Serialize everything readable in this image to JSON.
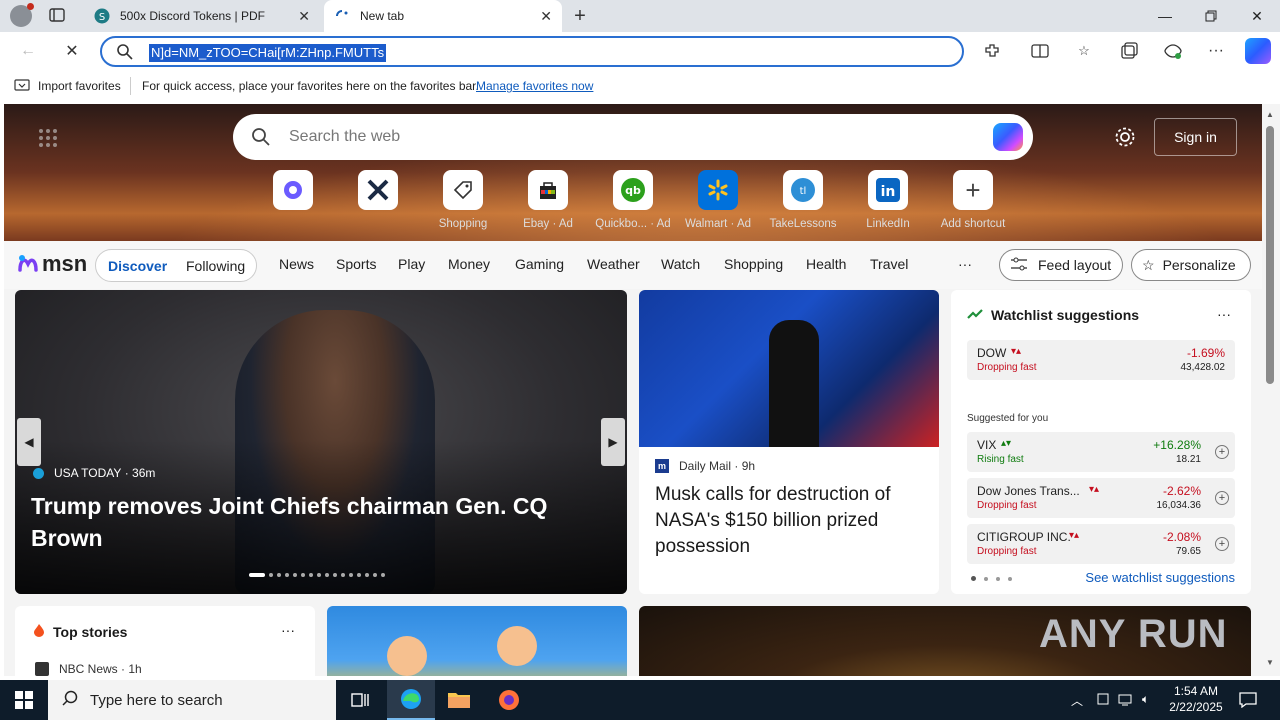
{
  "tabs": [
    {
      "title": "500x Discord Tokens | PDF"
    },
    {
      "title": "New tab"
    }
  ],
  "address": {
    "selected_text": "N]d=NM_zTOO=CHai[rM:ZHnp.FMUTTs"
  },
  "favorites": {
    "import_label": "Import favorites",
    "message": "For quick access, place your favorites here on the favorites bar.",
    "manage_link": "Manage favorites now"
  },
  "newtab": {
    "search_placeholder": "Search the web",
    "signin": "Sign in",
    "quicklinks": [
      {
        "label": ""
      },
      {
        "label": ""
      },
      {
        "label": "Shopping"
      },
      {
        "label": "Ebay · Ad"
      },
      {
        "label": "Quickbo... · Ad"
      },
      {
        "label": "Walmart · Ad"
      },
      {
        "label": "TakeLessons"
      },
      {
        "label": "LinkedIn"
      },
      {
        "label": "Add shortcut"
      }
    ]
  },
  "msn": {
    "logo": "msn",
    "tabs": [
      "Discover",
      "Following"
    ],
    "nav": [
      "News",
      "Sports",
      "Play",
      "Money",
      "Gaming",
      "Weather",
      "Watch",
      "Shopping",
      "Health",
      "Travel"
    ],
    "more": "···",
    "feed_layout": "Feed layout",
    "personalize": "Personalize"
  },
  "lead": {
    "source": "USA TODAY",
    "time": "· 36m",
    "headline": "Trump removes Joint Chiefs chairman Gen. CQ Brown"
  },
  "story2": {
    "source": "Daily Mail",
    "time": "· 9h",
    "headline": "Musk calls for destruction of NASA's $150 billion prized possession"
  },
  "watchlist": {
    "title": "Watchlist suggestions",
    "dow": {
      "name": "DOW",
      "status": "Dropping fast",
      "pct": "-1.69%",
      "value": "43,428.02"
    },
    "suggested_label": "Suggested for you",
    "stocks": [
      {
        "name": "VIX",
        "status": "Rising fast",
        "pct": "+16.28%",
        "value": "18.21",
        "up": true
      },
      {
        "name": "Dow Jones Trans...",
        "status": "Dropping fast",
        "pct": "-2.62%",
        "value": "16,034.36",
        "up": false
      },
      {
        "name": "CITIGROUP INC.",
        "status": "Dropping fast",
        "pct": "-2.08%",
        "value": "79.65",
        "up": false
      }
    ],
    "see_more": "See watchlist suggestions"
  },
  "topstories": {
    "title": "Top stories",
    "item_source": "NBC News · 1h"
  },
  "watermark": "ANY RUN",
  "taskbar": {
    "search_placeholder": "Type here to search",
    "time": "1:54 AM",
    "date": "2/22/2025"
  }
}
